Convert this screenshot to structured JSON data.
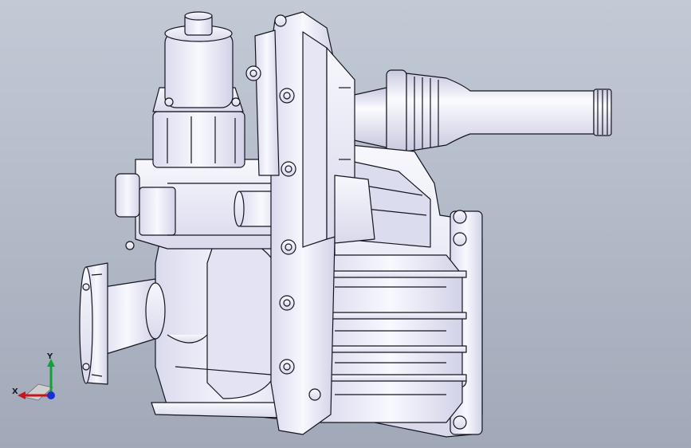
{
  "viewport": {
    "model": "transmission-assembly",
    "background_top": "#c3cad6",
    "background_bottom": "#a1a9b8",
    "part_fill": "#eeeef8",
    "part_shade": "#cfcfe4",
    "edge_color": "#15151f"
  },
  "triad": {
    "x_label": "X",
    "y_label": "Y",
    "x_color": "#c8141e",
    "y_color": "#12a03a",
    "z_color": "#1830d0"
  }
}
